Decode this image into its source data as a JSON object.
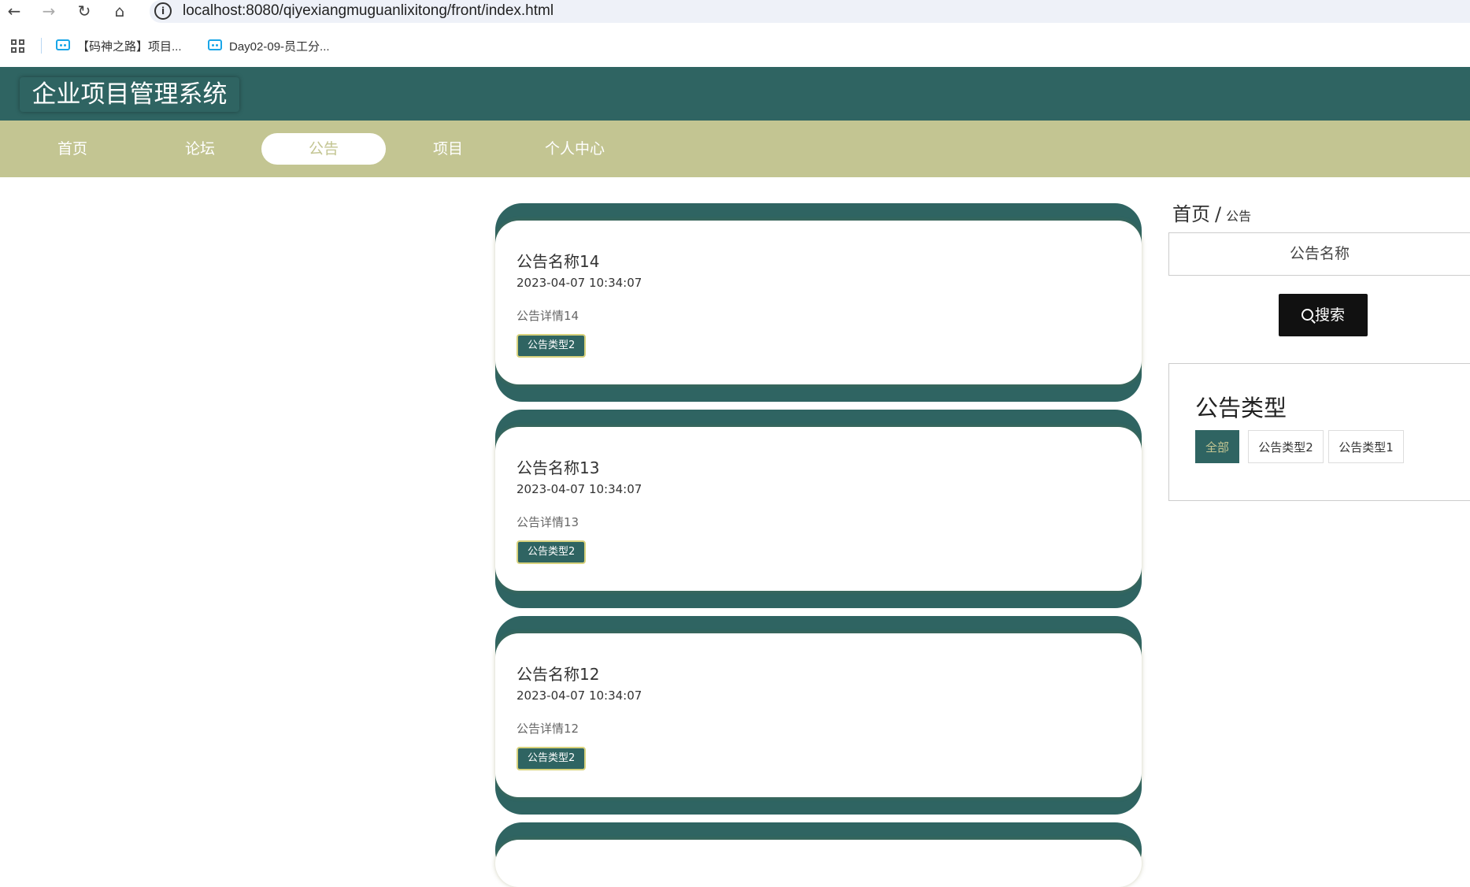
{
  "browser": {
    "url": "localhost:8080/qiyexiangmuguanlixitong/front/index.html",
    "bookmarks": [
      {
        "label": "【码神之路】项目..."
      },
      {
        "label": "Day02-09-员工分..."
      }
    ]
  },
  "site": {
    "title": "企业项目管理系统",
    "nav": [
      "首页",
      "论坛",
      "公告",
      "项目",
      "个人中心"
    ],
    "active_nav": "公告"
  },
  "notices": [
    {
      "title": "公告名称14",
      "date": "2023-04-07 10:34:07",
      "detail": "公告详情14",
      "type": "公告类型2"
    },
    {
      "title": "公告名称13",
      "date": "2023-04-07 10:34:07",
      "detail": "公告详情13",
      "type": "公告类型2"
    },
    {
      "title": "公告名称12",
      "date": "2023-04-07 10:34:07",
      "detail": "公告详情12",
      "type": "公告类型2"
    }
  ],
  "sidebar": {
    "breadcrumb": {
      "home": "首页",
      "separator": "/",
      "current": "公告"
    },
    "search_placeholder": "公告名称",
    "search_button": "搜索",
    "type_title": "公告类型",
    "types": [
      "全部",
      "公告类型2",
      "公告类型1"
    ],
    "active_type": "全部"
  },
  "colors": {
    "primary": "#2f6462",
    "nav": "#c3c592",
    "button_dark": "#111111"
  }
}
